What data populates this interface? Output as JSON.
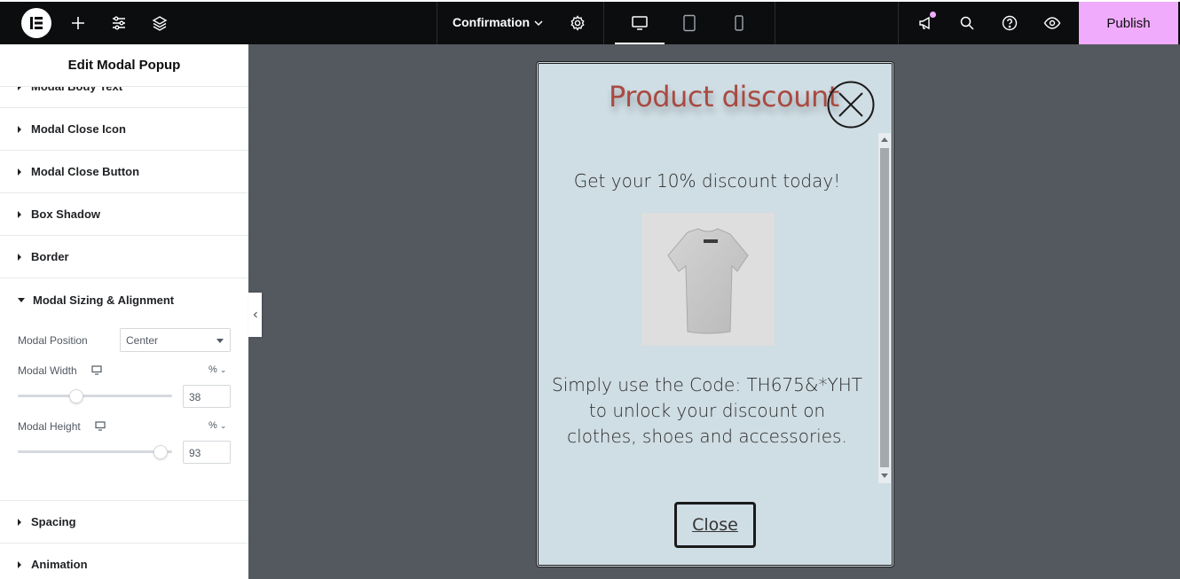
{
  "topbar": {
    "document_title": "Confirmation",
    "publish_label": "Publish"
  },
  "sidebar": {
    "title": "Edit Modal Popup",
    "sections": [
      {
        "label": "Modal Body Text"
      },
      {
        "label": "Modal Close Icon"
      },
      {
        "label": "Modal Close Button"
      },
      {
        "label": "Box Shadow"
      },
      {
        "label": "Border"
      },
      {
        "label": "Modal Sizing & Alignment"
      },
      {
        "label": "Spacing"
      },
      {
        "label": "Animation"
      }
    ],
    "modal_position": {
      "label": "Modal Position",
      "value": "Center"
    },
    "modal_width": {
      "label": "Modal Width",
      "unit": "%",
      "value": "38"
    },
    "modal_height": {
      "label": "Modal Height",
      "unit": "%",
      "value": "93"
    }
  },
  "modal": {
    "title": "Product discount",
    "line1": "Get your 10% discount today!",
    "line2": "Simply use the Code: TH675&*YHT to unlock your discount on clothes, shoes and accessories.",
    "close_button_label": "Close"
  },
  "colors": {
    "accent": "#f0abfc",
    "title": "#a94a42",
    "modal_bg": "#cfdde4",
    "canvas_bg": "#545960"
  }
}
